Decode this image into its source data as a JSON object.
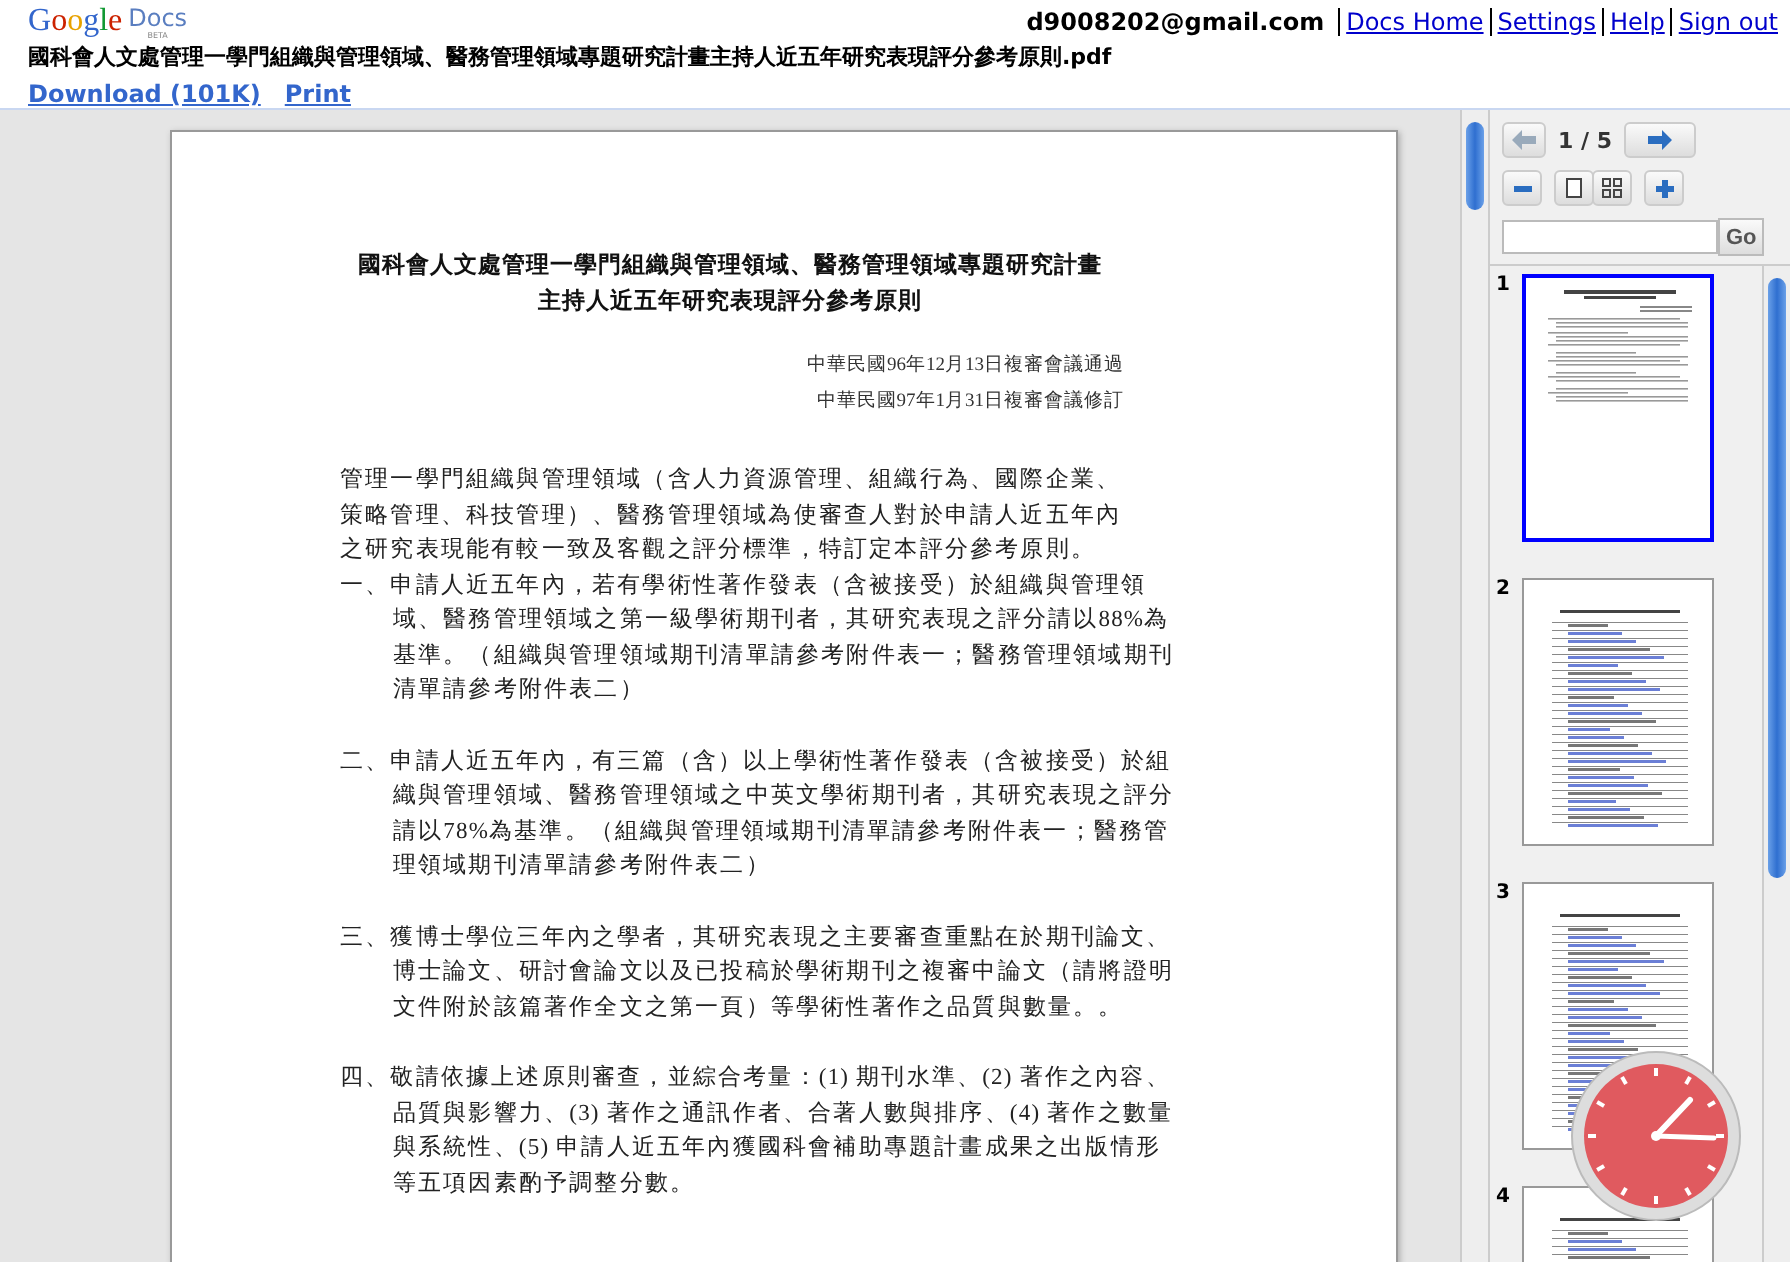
{
  "header": {
    "logo": {
      "brand": "Google",
      "product": "Docs",
      "badge": "BETA"
    },
    "account": "d9008202@gmail.com",
    "links": [
      "Docs Home",
      "Settings",
      "Help",
      "Sign out"
    ],
    "file_title": "國科會人文處管理一學門組織與管理領域、醫務管理領域專題研究計畫主持人近五年研究表現評分參考原則.pdf",
    "actions": [
      "Download (101K)",
      "Print"
    ]
  },
  "document": {
    "title_lines": [
      "國科會人文處管理一學門組織與管理領域、醫務管理領域專題研究計畫",
      "主持人近五年研究表現評分參考原則"
    ],
    "dates": [
      "中華民國96年12月13日複審會議通過",
      "中華民國97年1月31日複審會議修訂"
    ],
    "paragraphs": [
      {
        "kind": "intro",
        "text": "管理一學門組織與管理領域（含人力資源管理、組織行為、國際企業、策略管理、科技管理）、醫務管理領域為使審查人對於申請人近五年內之研究表現能有較一致及客觀之評分標準，特訂定本評分參考原則。"
      },
      {
        "kind": "item",
        "text": "一、申請人近五年內，若有學術性著作發表（含被接受）於組織與管理領域、醫務管理領域之第一級學術期刊者，其研究表現之評分請以88%為基準。（組織與管理領域期刊清單請參考附件表一；醫務管理領域期刊清單請參考附件表二）"
      },
      {
        "kind": "item",
        "text": "二、申請人近五年內，有三篇（含）以上學術性著作發表（含被接受）於組織與管理領域、醫務管理領域之中英文學術期刊者，其研究表現之評分請以78%為基準。（組織與管理領域期刊清單請參考附件表一；醫務管理領域期刊清單請參考附件表二）"
      },
      {
        "kind": "item",
        "text": "三、獲博士學位三年內之學者，其研究表現之主要審查重點在於期刊論文、博士論文、研討會論文以及已投稿於學術期刊之複審中論文（請將證明文件附於該篇著作全文之第一頁）等學術性著作之品質與數量。。"
      },
      {
        "kind": "item",
        "text": "四、敬請依據上述原則審查，並綜合考量：(1) 期刊水準、(2) 著作之內容、品質與影響力、(3) 著作之通訊作者、合著人數與排序、(4) 著作之數量與系統性、(5) 申請人近五年內獲國科會補助專題計畫成果之出版情形等五項因素酌予調整分數。"
      }
    ]
  },
  "viewer": {
    "page_indicator": "1 / 5",
    "goto_button": "Go",
    "thumbnails": [
      {
        "label": "1",
        "selected": true,
        "kind": "text"
      },
      {
        "label": "2",
        "selected": false,
        "kind": "table"
      },
      {
        "label": "3",
        "selected": false,
        "kind": "table"
      },
      {
        "label": "4",
        "selected": false,
        "kind": "table"
      }
    ]
  }
}
